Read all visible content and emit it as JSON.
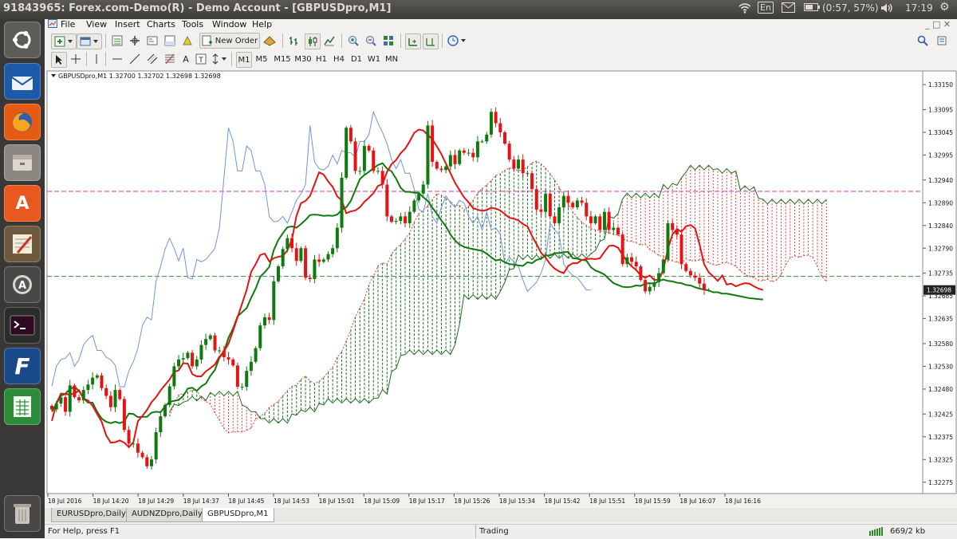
{
  "window_title": "91843965: Forex.com-Demo(R) - Demo Account - [GBPUSDpro,M1]",
  "top_indicators": {
    "wifi_icon": "wifi-icon",
    "keyboard": "En",
    "mail_icon": "mail-icon",
    "battery": "(0:57, 57%)",
    "volume_icon": "volume-icon",
    "clock": "17:19",
    "gear_icon": "gear-icon"
  },
  "menu": [
    "File",
    "View",
    "Insert",
    "Charts",
    "Tools",
    "Window",
    "Help"
  ],
  "toolbar": {
    "new_order_label": "New Order"
  },
  "timeframes": [
    "M1",
    "M5",
    "M15",
    "M30",
    "H1",
    "H4",
    "D1",
    "W1",
    "MN"
  ],
  "chart_data": {
    "type": "candlestick",
    "title": "GBPUSDpro,M1  1.32700 1.32702 1.32698 1.32698",
    "symbol": "GBPUSDpro,M1",
    "ohlc_header": [
      "1.32700",
      "1.32702",
      "1.32698",
      "1.32698"
    ],
    "current_price_label": "1.32698",
    "ylim": [
      1.3225,
      1.3318
    ],
    "y_ticks": [
      "1.33150",
      "1.33095",
      "1.33045",
      "1.32995",
      "1.32940",
      "1.32890",
      "1.32840",
      "1.32790",
      "1.32735",
      "1.32685",
      "1.32635",
      "1.32580",
      "1.32530",
      "1.32480",
      "1.32425",
      "1.32375",
      "1.32325",
      "1.32275"
    ],
    "x_ticks": [
      "18 Jul 2016",
      "18 Jul 14:20",
      "18 Jul 14:29",
      "18 Jul 14:37",
      "18 Jul 14:45",
      "18 Jul 14:53",
      "18 Jul 15:01",
      "18 Jul 15:09",
      "18 Jul 15:17",
      "18 Jul 15:26",
      "18 Jul 15:34",
      "18 Jul 15:42",
      "18 Jul 15:51",
      "18 Jul 15:59",
      "18 Jul 16:07",
      "18 Jul 16:16"
    ],
    "hlines": [
      {
        "price": 1.32915,
        "color": "#cc33cc"
      },
      {
        "price": 1.32728,
        "color": "#3a8a3a"
      }
    ],
    "bars": 160,
    "close": [
      1.32435,
      1.32448,
      1.32462,
      1.3243,
      1.32488,
      1.32462,
      1.32455,
      1.32478,
      1.3249,
      1.32505,
      1.3251,
      1.32482,
      1.32465,
      1.3244,
      1.32478,
      1.32458,
      1.3239,
      1.3236,
      1.3236,
      1.3234,
      1.3233,
      1.3231,
      1.32325,
      1.32385,
      1.3242,
      1.32445,
      1.32486,
      1.3253,
      1.32545,
      1.32548,
      1.3256,
      1.3253,
      1.32545,
      1.32577,
      1.3259,
      1.32598,
      1.32565,
      1.32565,
      1.3255,
      1.32545,
      1.32532,
      1.32485,
      1.32485,
      1.3252,
      1.3254,
      1.3257,
      1.3262,
      1.32638,
      1.32632,
      1.32717,
      1.3275,
      1.32788,
      1.32812,
      1.3279,
      1.32762,
      1.3279,
      1.32725,
      1.32722,
      1.32765,
      1.3276,
      1.32765,
      1.32777,
      1.3279,
      1.32835,
      1.32945,
      1.33055,
      1.33025,
      1.3296,
      1.3296,
      1.33015,
      1.33005,
      1.3296,
      1.3296,
      1.3293,
      1.3286,
      1.32848,
      1.3285,
      1.3286,
      1.32845,
      1.3287,
      1.32895,
      1.3291,
      1.3293,
      1.3306,
      1.3298,
      1.32965,
      1.32962,
      1.3297,
      1.32995,
      1.32975,
      1.33005,
      1.33,
      1.33,
      1.3299,
      1.33025,
      1.33025,
      1.3304,
      1.3309,
      1.33065,
      1.33045,
      1.3302,
      1.32985,
      1.32965,
      1.32985,
      1.32955,
      1.32955,
      1.3292,
      1.32875,
      1.3287,
      1.3291,
      1.3286,
      1.32845,
      1.3288,
      1.32905,
      1.3289,
      1.3288,
      1.32895,
      1.3289,
      1.3286,
      1.32845,
      1.3286,
      1.3283,
      1.3287,
      1.3283,
      1.32835,
      1.3282,
      1.32755,
      1.3277,
      1.3276,
      1.3275,
      1.3272,
      1.32695,
      1.32705,
      1.32715,
      1.32735,
      1.32765,
      1.32845,
      1.3283,
      1.3282,
      1.32755,
      1.3274,
      1.3273,
      1.32725,
      1.32712,
      1.32698,
      1.32698
    ],
    "tenkan": [
      1.3241,
      1.32448,
      1.3247,
      1.32469,
      1.32468,
      1.3247,
      1.32477,
      1.32459,
      1.32455,
      1.32443,
      1.32425,
      1.32408,
      1.32378,
      1.32362,
      1.32363,
      1.32367,
      1.32362,
      1.32352,
      1.32363,
      1.32409,
      1.32421,
      1.32434,
      1.32451,
      1.32462,
      1.32477,
      1.32489,
      1.32501,
      1.32518,
      1.32521,
      1.32537,
      1.32536,
      1.32513,
      1.32508,
      1.32508,
      1.32519,
      1.32526,
      1.32534,
      1.32551,
      1.32563,
      1.3258,
      1.32608,
      1.32638,
      1.32668,
      1.32698,
      1.32738,
      1.32755,
      1.32775,
      1.32778,
      1.32761,
      1.32768,
      1.32771,
      1.32773,
      1.32785,
      1.32809,
      1.32861,
      1.32889,
      1.32894,
      1.32905,
      1.32931,
      1.32957,
      1.32952,
      1.32937,
      1.32925,
      1.32904,
      1.32895,
      1.32867,
      1.32871,
      1.32873,
      1.3288,
      1.32892,
      1.32901,
      1.32911,
      1.32927,
      1.32931,
      1.32958,
      1.32975,
      1.32984,
      1.32999,
      1.33009,
      1.33025,
      1.33044,
      1.33051,
      1.33049,
      1.33039,
      1.3303,
      1.33014,
      1.32997,
      1.32976,
      1.32955,
      1.32934,
      1.32918,
      1.32902,
      1.32891,
      1.32878,
      1.32875,
      1.32872,
      1.32874,
      1.32879,
      1.32877,
      1.32873,
      1.32865,
      1.32857,
      1.32855,
      1.32851,
      1.32843,
      1.32838,
      1.32817,
      1.32799,
      1.3278,
      1.32769,
      1.32755,
      1.32745,
      1.32739,
      1.32735,
      1.32751,
      1.32757,
      1.32757,
      1.32764,
      1.32766,
      1.32767,
      1.32766,
      1.32768,
      1.32782,
      1.32795,
      1.32796,
      1.32791,
      1.32775,
      1.32761,
      1.3275,
      1.32742,
      1.3273,
      1.32725,
      1.3273,
      1.3272,
      1.32721,
      1.32743,
      1.32788,
      1.3282,
      1.32832,
      1.32826,
      1.32838,
      1.32841,
      1.32834,
      1.32798,
      1.32755,
      1.32737,
      1.32728,
      1.32718,
      1.3273,
      1.3271,
      1.32712,
      1.32706,
      1.3271,
      1.32713,
      1.32712,
      1.32706,
      1.32701,
      1.32698
    ],
    "kijun": [
      1.3243,
      1.32448,
      1.32465,
      1.3247,
      1.3248,
      1.32485,
      1.32476,
      1.3246,
      1.3245,
      1.3245,
      1.3243,
      1.32415,
      1.32408,
      1.32405,
      1.32408,
      1.32405,
      1.32409,
      1.32426,
      1.32425,
      1.32418,
      1.32419,
      1.32419,
      1.32428,
      1.3243,
      1.32429,
      1.32442,
      1.32452,
      1.32454,
      1.32456,
      1.32465,
      1.32481,
      1.32483,
      1.32476,
      1.32486,
      1.32492,
      1.32509,
      1.32522,
      1.32549,
      1.32562,
      1.32593,
      1.32613,
      1.3264,
      1.32649,
      1.32658,
      1.32681,
      1.32701,
      1.32727,
      1.32737,
      1.32749,
      1.32786,
      1.32808,
      1.32823,
      1.32836,
      1.32838,
      1.32835,
      1.32843,
      1.32852,
      1.32863,
      1.32864,
      1.32863,
      1.32861,
      1.32862,
      1.32861,
      1.32864,
      1.32874,
      1.3288,
      1.32894,
      1.32918,
      1.32942,
      1.32951,
      1.32958,
      1.32966,
      1.32973,
      1.32977,
      1.32965,
      1.32959,
      1.32943,
      1.32923,
      1.32914,
      1.32914,
      1.32912,
      1.32912,
      1.32902,
      1.32894,
      1.32879,
      1.32866,
      1.32851,
      1.32838,
      1.3282,
      1.32807,
      1.32798,
      1.32793,
      1.3279,
      1.32788,
      1.32786,
      1.32784,
      1.32778,
      1.3277,
      1.32763,
      1.32765,
      1.32759,
      1.32755,
      1.32754,
      1.32752,
      1.32751,
      1.32759,
      1.32757,
      1.32764,
      1.32767,
      1.32774,
      1.32774,
      1.32779,
      1.32779,
      1.32781,
      1.32782,
      1.32768,
      1.32767,
      1.32764,
      1.32763,
      1.32748,
      1.32741,
      1.32737,
      1.32732,
      1.32722,
      1.32713,
      1.32709,
      1.32705,
      1.32704,
      1.32705,
      1.32708,
      1.32707,
      1.32712,
      1.32713,
      1.32712,
      1.32718,
      1.32721,
      1.32718,
      1.32717,
      1.32714,
      1.32713,
      1.32709,
      1.32708,
      1.32704,
      1.32701,
      1.32699,
      1.32697,
      1.32693,
      1.32693,
      1.3269,
      1.3269,
      1.32688,
      1.32686,
      1.32684,
      1.32682,
      1.3268,
      1.32679,
      1.32678,
      1.32677
    ]
  },
  "tabs": [
    "EURUSDpro,Daily",
    "AUDNZDpro,Daily",
    "GBPUSDpro,M1"
  ],
  "active_tab": 2,
  "status": {
    "help": "For Help, press F1",
    "mode": "Trading",
    "traffic": "669/2 kb"
  }
}
